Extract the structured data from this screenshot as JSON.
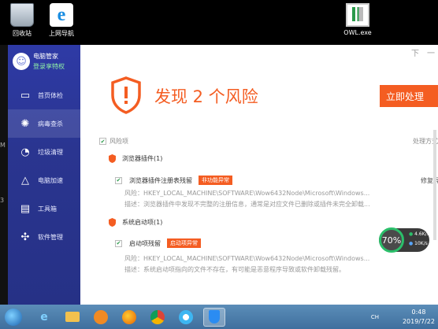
{
  "desktop": {
    "icons": [
      {
        "label": "回收站",
        "icon": "recycle-bin-icon"
      },
      {
        "label": "上网导航",
        "icon": "ie-icon"
      },
      {
        "label": "OWL.exe",
        "icon": "exe-icon"
      }
    ],
    "strip_glyphs": [
      "M",
      "3"
    ]
  },
  "app": {
    "user": {
      "name": "电脑管家",
      "login": "登录享特权"
    },
    "nav": [
      {
        "label": "首页体检",
        "icon": "monitor-icon",
        "active": false
      },
      {
        "label": "病毒查杀",
        "icon": "virus-scan-icon",
        "active": true
      },
      {
        "label": "垃圾清理",
        "icon": "trash-clean-icon",
        "active": false
      },
      {
        "label": "电脑加速",
        "icon": "rocket-icon",
        "active": false
      },
      {
        "label": "工具箱",
        "icon": "toolbox-icon",
        "active": false
      },
      {
        "label": "软件管理",
        "icon": "software-icon",
        "active": false
      }
    ],
    "window_controls": [
      "下",
      "一"
    ],
    "hero": {
      "title": "发现 2 个风险",
      "button": "立即处理"
    },
    "list_header": {
      "left": "风险项",
      "right": "处理方式"
    },
    "groups": [
      {
        "title": "浏览器插件(1)",
        "item": {
          "label": "浏览器插件注册表残留",
          "tag": "非功能异常",
          "status": "修复异",
          "risk": "风险：HKEY_LOCAL_MACHINE\\SOFTWARE\\Wow6432Node\\Microsoft\\Windows...",
          "desc": "描述：浏览器插件中发现不完整的注册信息，通常是对应文件已删除或插件未完全卸载..."
        }
      },
      {
        "title": "系统启动项(1)",
        "item": {
          "label": "启动项残留",
          "tag": "启动项异常",
          "status": "",
          "risk": "风险：HKEY_LOCAL_MACHINE\\SOFTWARE\\Wow6432Node\\Microsoft\\Windows...",
          "desc": "描述：系统启动项指向的文件不存在，有可能是恶意程序导致或软件卸载残留。"
        }
      }
    ],
    "speed_widget": {
      "percent": "70%",
      "up": "4.6K/s",
      "down": "10K/s"
    }
  },
  "taskbar": {
    "apps": [
      {
        "icon": "ie-icon",
        "active": false
      },
      {
        "icon": "folder-icon",
        "active": false
      },
      {
        "icon": "media-player-icon",
        "active": false
      },
      {
        "icon": "firefox-icon",
        "active": false
      },
      {
        "icon": "chrome-icon",
        "active": false
      },
      {
        "icon": "qq-browser-icon",
        "active": false
      },
      {
        "icon": "tencent-pc-manager-icon",
        "active": true
      }
    ],
    "ime": "CH",
    "time": "0:48",
    "date": "2019/7/22"
  },
  "colors": {
    "accent": "#f45d22",
    "sidebar": "#2e3aa6",
    "taskbar": "#4a7aa8"
  }
}
